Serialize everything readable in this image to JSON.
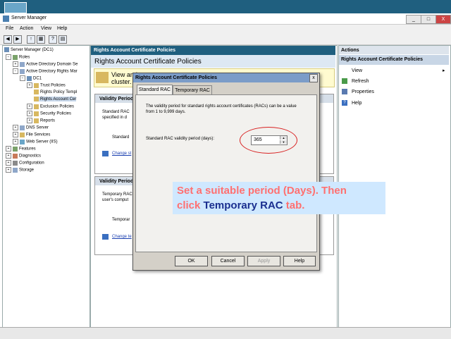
{
  "window": {
    "title": "Server Manager",
    "buttons": [
      "_",
      "□",
      "X"
    ]
  },
  "menu": [
    "File",
    "Action",
    "View",
    "Help"
  ],
  "tree": [
    {
      "label": "Server Manager (DC1)"
    },
    {
      "label": "Roles"
    },
    {
      "label": "Active Directory Domain Se"
    },
    {
      "label": "Active Directory Rights Mar"
    },
    {
      "label": "DC1"
    },
    {
      "label": "Trust Policies"
    },
    {
      "label": "Rights Policy Templ"
    },
    {
      "label": "Rights Account Cer"
    },
    {
      "label": "Exclusion Policies"
    },
    {
      "label": "Security Policies"
    },
    {
      "label": "Reports"
    },
    {
      "label": "DNS Server"
    },
    {
      "label": "File Services"
    },
    {
      "label": "Web Server (IIS)"
    },
    {
      "label": "Features"
    },
    {
      "label": "Diagnostics"
    },
    {
      "label": "Configuration"
    },
    {
      "label": "Storage"
    }
  ],
  "center": {
    "header": "Rights Account Certificate Policies",
    "subtitle": "Rights Account Certificate Policies",
    "info_line1": "View and",
    "info_line2": "cluster.",
    "group1": {
      "title": "Validity Period",
      "text1": "Standard RAC",
      "text2": "specified in d",
      "label": "Standard",
      "link": "Change st"
    },
    "group2": {
      "title": "Validity Period",
      "text1": "Temporary RAC",
      "text2": "user's comput",
      "label": "Temporar",
      "link": "Change te"
    }
  },
  "actions": {
    "header": "Actions",
    "section": "Rights Account Certificate Policies",
    "items": [
      {
        "label": "View",
        "icon": "none"
      },
      {
        "label": "Refresh",
        "icon": "refresh-icon"
      },
      {
        "label": "Properties",
        "icon": "properties-icon"
      },
      {
        "label": "Help",
        "icon": "help-icon"
      }
    ]
  },
  "dialog": {
    "title": "Rights Account Certificate Policies",
    "close": "x",
    "tabs": [
      "Standard RAC",
      "Temporary RAC"
    ],
    "description": "The validity period for standard rights account certificates (RACs) can be a value from 1 to 9,999 days.",
    "field_label": "Standard RAC validity period (days):",
    "field_value": "365",
    "buttons": {
      "ok": "OK",
      "cancel": "Cancel",
      "apply": "Apply",
      "help": "Help"
    }
  },
  "callout": {
    "line1": "Set a suitable period (Days). Then",
    "line2_a": "click ",
    "line2_b": "Temporary RAC",
    "line2_c": " tab."
  },
  "colors": {
    "titlebar": "#1f5f7f",
    "callout_bg": "#cfe8ff",
    "callout_text": "#ff7070",
    "callout_emph": "#1a2f8f",
    "highlight_ring": "#d82020"
  }
}
